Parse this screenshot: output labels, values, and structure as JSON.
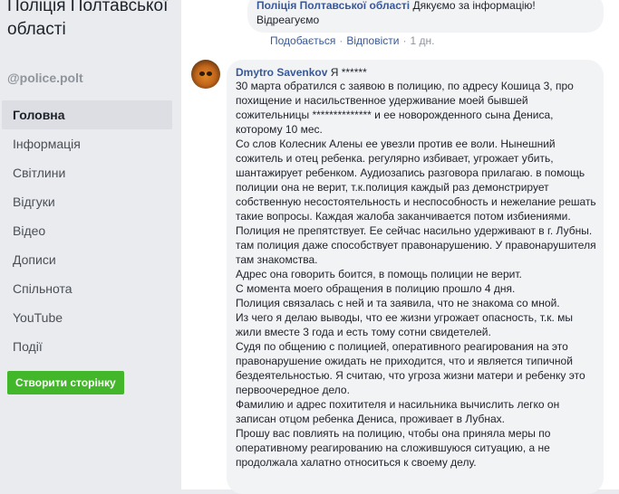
{
  "sidebar": {
    "page_name": "Поліція Полтавської області",
    "handle": "@police.polt",
    "nav": [
      {
        "label": "Головна",
        "active": true
      },
      {
        "label": "Інформація"
      },
      {
        "label": "Світлини"
      },
      {
        "label": "Відгуки"
      },
      {
        "label": "Відео"
      },
      {
        "label": "Дописи"
      },
      {
        "label": "Спільнота"
      },
      {
        "label": "YouTube"
      },
      {
        "label": "Події"
      }
    ],
    "create_page_button": "Створити сторінку"
  },
  "reply": {
    "author": "Поліція Полтавської області",
    "text": "Дякуємо за інформацію! Відреагуємо",
    "like": "Подобається",
    "reply": "Відповісти",
    "time": "1 дн."
  },
  "comment": {
    "author": "Dmytro Savenkov",
    "greeting": "Я ******",
    "paragraphs": [
      "30 марта обратился с заявою в полицию, по адресу Кошица 3, про похищение и насильственное удерживание моей бывшей сожительницы ************** и ее новорожденного сына Дениса, которому 10 мес.",
      "Со слов Колесник Алены ее увезли против ее воли. Нынешний сожитель и отец ребенка. регулярно избивает, угрожает убить, шантажирует ребенком. Аудиозапись разговора прилагаю. в помощь полиции она не верит, т.к.полиция каждый раз демонстрирует собственную несостоятельность и неспособность и нежелание решать такие вопросы. Каждая жалоба заканчивается потом избиениями. Полиция не препятствует. Ее сейчас насильно удерживают в г. Лубны. там полиция даже способствует правонарушению. У правонарушителя там знакомства.",
      "Адрес она говорить боится, в помощь полиции не верит.",
      "С момента моего обращения в полицию прошло 4 дня.",
      "Полиция связалась с ней и та заявила, что не знакома со мной.",
      "Из чего я делаю выводы, что ее жизни угрожает опасность, т.к. мы жили вместе 3 года и есть тому сотни свидетелей.",
      "Судя по общению с полицией, оперативного реагирования на это правонарушение ожидать не приходится, что и является типичной бездеятельностью. Я считаю, что угроза жизни матери и ребенку это первоочередное дело.",
      "Фамилию и адрес похитителя и насильника вычислить легко он записан отцом ребенка Дениса, проживает в Лубнах.",
      "Прошу вас повлиять на полицию, чтобы она приняла меры по оперативному реагированию на сложившуюся ситуацию, а не продолжала халатно относиться к своему делу."
    ]
  }
}
